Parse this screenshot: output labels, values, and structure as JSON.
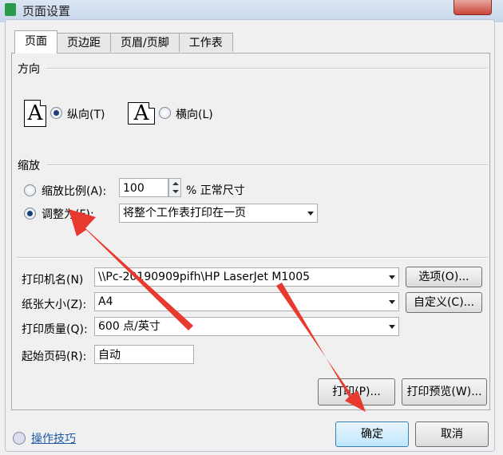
{
  "window": {
    "title": "页面设置"
  },
  "tabs": [
    {
      "label": "页面",
      "active": true
    },
    {
      "label": "页边距",
      "active": false
    },
    {
      "label": "页眉/页脚",
      "active": false
    },
    {
      "label": "工作表",
      "active": false
    }
  ],
  "orientation": {
    "section_label": "方向",
    "portrait_label": "纵向(T)",
    "landscape_label": "横向(L)",
    "icon_glyph": "A",
    "selected": "portrait"
  },
  "scaling": {
    "section_label": "缩放",
    "ratio_label": "缩放比例(A):",
    "ratio_value": "100",
    "ratio_suffix": "% 正常尺寸",
    "fit_label": "调整为(F):",
    "fit_value": "将整个工作表打印在一页",
    "selected": "fit"
  },
  "printer": {
    "name_label": "打印机名(N)",
    "name_value": "\\\\Pc-20190909pifh\\HP LaserJet M1005",
    "options_button": "选项(O)...",
    "paper_label": "纸张大小(Z):",
    "paper_value": "A4",
    "custom_button": "自定义(C)...",
    "quality_label": "打印质量(Q):",
    "quality_value": "600 点/英寸",
    "start_page_label": "起始页码(R):",
    "start_page_value": "自动"
  },
  "actions": {
    "print_button": "打印(P)...",
    "preview_button": "打印预览(W)...",
    "ok_button": "确定",
    "cancel_button": "取消",
    "tips_link": "操作技巧"
  },
  "annotation": {
    "color": "#e8392f"
  }
}
